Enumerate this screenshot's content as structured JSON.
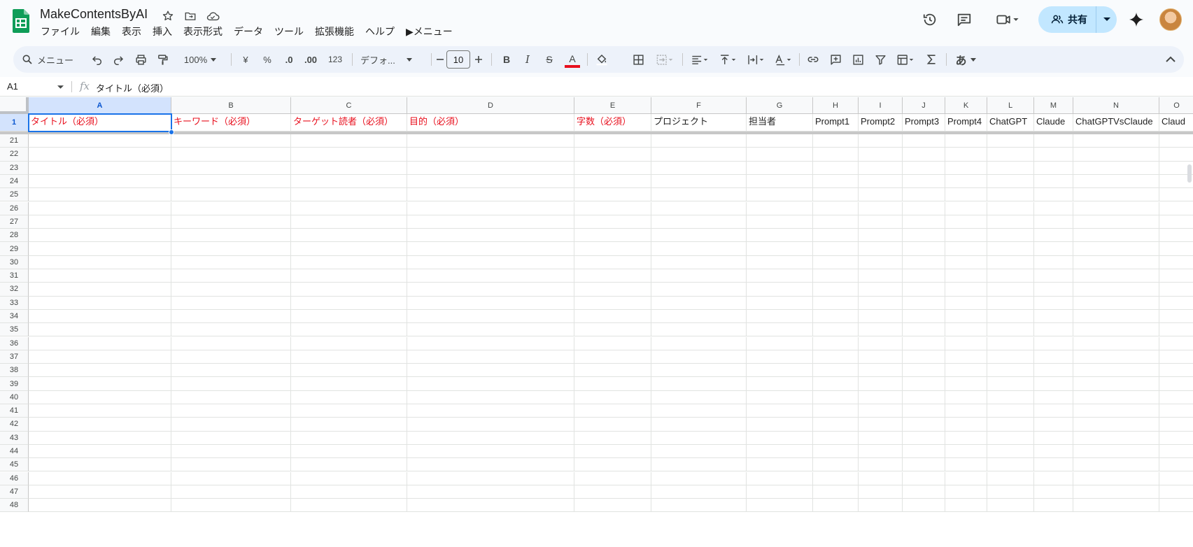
{
  "document": {
    "title": "MakeContentsByAI"
  },
  "menus": [
    "ファイル",
    "編集",
    "表示",
    "挿入",
    "表示形式",
    "データ",
    "ツール",
    "拡張機能",
    "ヘルプ",
    "▶メニュー"
  ],
  "header_actions": {
    "share_label": "共有"
  },
  "toolbar": {
    "search_label": "メニュー",
    "zoom": "100%",
    "currency": "¥",
    "percent": "%",
    "decrease_decimal": ".0",
    "increase_decimal": ".00",
    "number_format": "123",
    "font": "デフォ...",
    "font_size": "10",
    "bold": "B",
    "italic": "I",
    "strikethrough": "S",
    "text_color": "A",
    "input_tools": "あ",
    "text_color_hex": "#e8101e"
  },
  "formula_bar": {
    "cell_ref": "A1",
    "fx": "fx",
    "content": "タイトル（必須）"
  },
  "grid": {
    "columns": [
      "A",
      "B",
      "C",
      "D",
      "E",
      "F",
      "G",
      "H",
      "I",
      "J",
      "K",
      "L",
      "M",
      "N",
      "O"
    ],
    "header_row_number": "1",
    "header_cells": [
      {
        "text": "タイトル（必須）",
        "required": true
      },
      {
        "text": "キーワード（必須）",
        "required": true
      },
      {
        "text": "ターゲット読者（必須）",
        "required": true
      },
      {
        "text": "目的（必須）",
        "required": true
      },
      {
        "text": "字数（必須）",
        "required": true
      },
      {
        "text": "プロジェクト",
        "required": false
      },
      {
        "text": "担当者",
        "required": false
      },
      {
        "text": "Prompt1",
        "required": false
      },
      {
        "text": "Prompt2",
        "required": false
      },
      {
        "text": "Prompt3",
        "required": false
      },
      {
        "text": "Prompt4",
        "required": false
      },
      {
        "text": "ChatGPT",
        "required": false
      },
      {
        "text": "Claude",
        "required": false
      },
      {
        "text": "ChatGPTVsClaude",
        "required": false
      },
      {
        "text": "Claud",
        "required": false
      }
    ],
    "row_numbers": [
      "21",
      "22",
      "23",
      "24",
      "25",
      "26",
      "27",
      "28",
      "29",
      "30",
      "31",
      "32",
      "33",
      "34",
      "35",
      "36",
      "37",
      "38",
      "39",
      "40",
      "41",
      "42",
      "43",
      "44",
      "45",
      "46",
      "47",
      "48"
    ],
    "required_color": "#e8101e",
    "selection_color": "#1a73e8"
  }
}
